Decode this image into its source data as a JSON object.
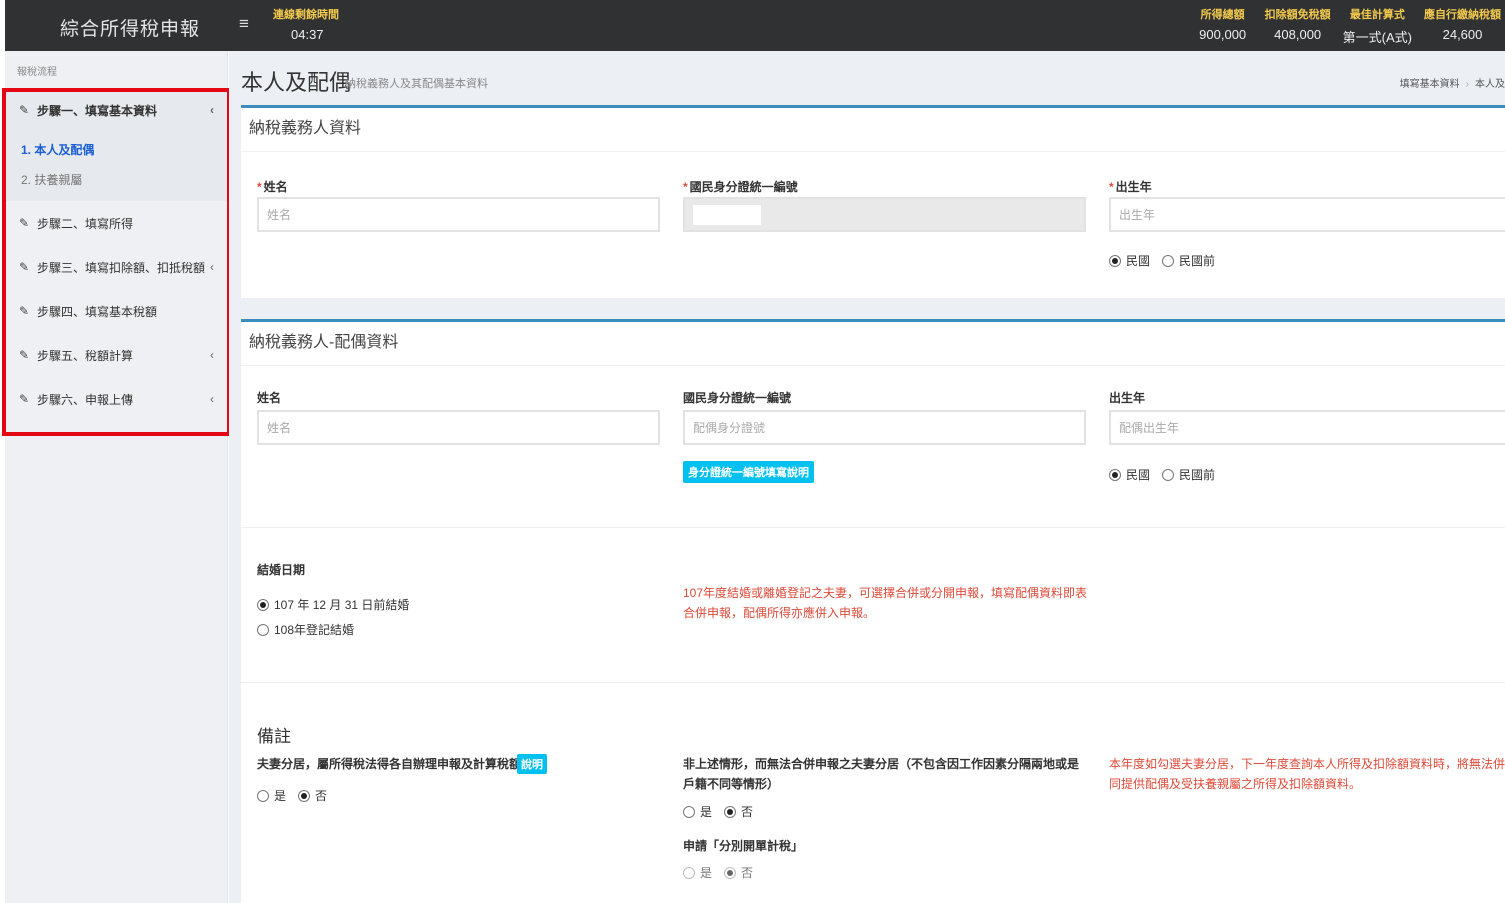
{
  "app": {
    "title": "綜合所得稅申報",
    "menu_icon": "≡"
  },
  "timer": {
    "label": "連線剩餘時間",
    "value": "04:37"
  },
  "stats": [
    {
      "label": "所得總額",
      "value": "900,000"
    },
    {
      "label": "扣除額免稅額",
      "value": "408,000"
    },
    {
      "label": "最佳計算式",
      "value": "第一式(A式)"
    },
    {
      "label": "應自行繳納稅額",
      "value": "24,600"
    }
  ],
  "sidebar": {
    "title": "報稅流程",
    "steps": [
      {
        "label": "步驟一、填寫基本資料"
      },
      {
        "label": "步驟二、填寫所得"
      },
      {
        "label": "步驟三、填寫扣除額、扣抵稅額"
      },
      {
        "label": "步驟四、填寫基本稅額"
      },
      {
        "label": "步驟五、稅額計算"
      },
      {
        "label": "步驟六、申報上傳"
      }
    ],
    "substeps": [
      {
        "label": "1. 本人及配偶"
      },
      {
        "label": "2. 扶養親屬"
      }
    ]
  },
  "page": {
    "title": "本人及配偶",
    "subtitle": "納稅義務人及其配偶基本資料",
    "breadcrumb": [
      "填寫基本資料",
      "本人及"
    ]
  },
  "taxpayer": {
    "heading": "納稅義務人資料",
    "name_label": "姓名",
    "name_placeholder": "姓名",
    "id_label": "國民身分證統一編號",
    "birth_label": "出生年",
    "birth_placeholder": "出生年",
    "era_options": [
      "民國",
      "民國前"
    ]
  },
  "spouse": {
    "heading": "納稅義務人-配偶資料",
    "name_label": "姓名",
    "name_placeholder": "姓名",
    "id_label": "國民身分證統一編號",
    "id_placeholder": "配偶身分證號",
    "id_help_button": "身分證統一編號填寫說明",
    "birth_label": "出生年",
    "birth_placeholder": "配偶出生年",
    "era_options": [
      "民國",
      "民國前"
    ],
    "marriage_label": "結婚日期",
    "marriage_options": [
      "107 年 12 月 31 日前結婚",
      "108年登記結婚"
    ],
    "marriage_note": "107年度結婚或離婚登記之夫妻，可選擇合併或分開申報，填寫配偶資料即表合併申報，配偶所得亦應併入申報。"
  },
  "remarks": {
    "title": "備註",
    "q1": "夫妻分居，屬所得稅法得各自辦理申報及計算稅額者",
    "q1_button": "說明",
    "q2": "非上述情形，而無法合併申報之夫妻分居（不包含因工作因素分隔兩地或是戶籍不同等情形）",
    "q3": "申請「分別開單計稅」",
    "yes": "是",
    "no": "否",
    "note": "本年度如勾選夫妻分居，下一年度查詢本人所得及扣除額資料時，將無法併同提供配偶及受扶養親屬之所得及扣除額資料。"
  }
}
